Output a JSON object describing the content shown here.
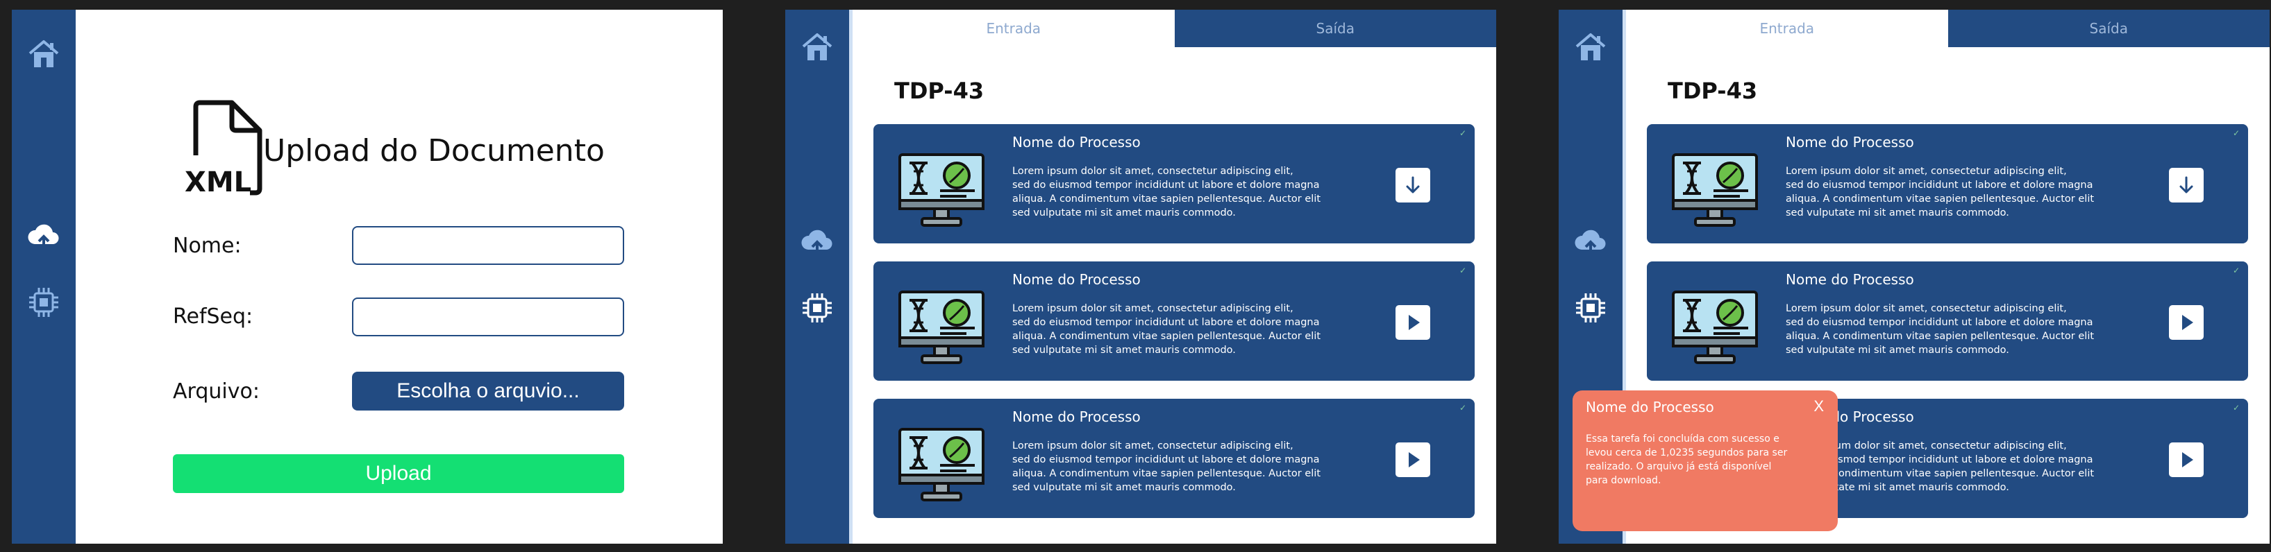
{
  "upload_screen": {
    "doc_icon_label": "XML",
    "title": "Upload do Documento",
    "name_label": "Nome:",
    "name_value": "",
    "refseq_label": "RefSeq:",
    "refseq_value": "",
    "file_label": "Arquivo:",
    "file_button": "Escolha o arquvio...",
    "upload_button": "Upload"
  },
  "results_screen": {
    "tabs": [
      {
        "label": "Entrada",
        "active": true
      },
      {
        "label": "Saída",
        "active": false
      }
    ],
    "title": "TDP-43",
    "cards": [
      {
        "title": "Nome do Processo",
        "body_lines": [
          "Lorem ipsum dolor sit amet, consectetur adipiscing elit,",
          "sed do eiusmod tempor incididunt ut labore et dolore magna",
          "aliqua. A condimentum vitae sapien pellentesque. Auctor elit",
          "sed vulputate mi sit amet mauris commodo."
        ],
        "action_icon": "download-arrow-icon"
      },
      {
        "title": "Nome do Processo",
        "body_lines": [
          "Lorem ipsum dolor sit amet, consectetur adipiscing elit,",
          "sed do eiusmod tempor incididunt ut labore et dolore magna",
          "aliqua. A condimentum vitae sapien pellentesque. Auctor elit",
          "sed vulputate mi sit amet mauris commodo."
        ],
        "action_icon": "play-icon"
      },
      {
        "title": "Nome do Processo",
        "body_lines": [
          "Lorem ipsum dolor sit amet, consectetur adipiscing elit,",
          "sed do eiusmod tempor incididunt ut labore et dolore magna",
          "aliqua. A condimentum vitae sapien pellentesque. Auctor elit",
          "sed vulputate mi sit amet mauris commodo."
        ],
        "action_icon": "play-icon"
      }
    ]
  },
  "toast": {
    "title": "Nome do Processo",
    "close": "X",
    "body_lines": [
      "Essa tarefa foi concluída com sucesso e",
      "levou cerca de 1,0235 segundos para ser",
      "realizado. O arquivo já está disponível",
      "para download."
    ]
  },
  "colors": {
    "sidebar": "#224b82",
    "upload_button": "#14df73",
    "toast": "#f07a63",
    "background": "#1f1f1f"
  }
}
